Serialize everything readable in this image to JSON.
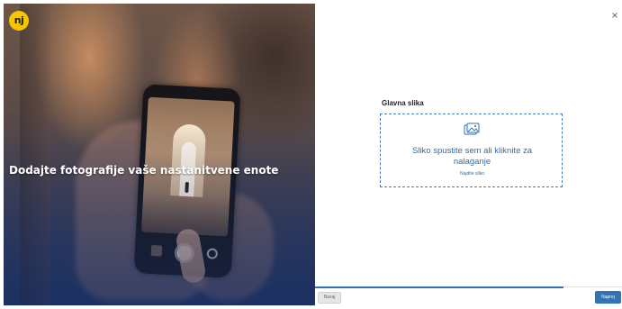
{
  "hero": {
    "logo_text": "nj",
    "title": "Dodajte fotografije vaše nastanitvene enote"
  },
  "dialog": {
    "close_label": "×"
  },
  "upload": {
    "section_label": "Glavna slika",
    "icon": "image-icon",
    "dropzone_text": "Sliko spustite sem ali kliknite za nalaganje",
    "find_link": "Najdite sliko"
  },
  "footer": {
    "back_label": "Nazaj",
    "next_label": "Naprej",
    "progress_percent": 83
  },
  "colors": {
    "accent": "#2f74b5",
    "logo_yellow": "#f6c500"
  }
}
